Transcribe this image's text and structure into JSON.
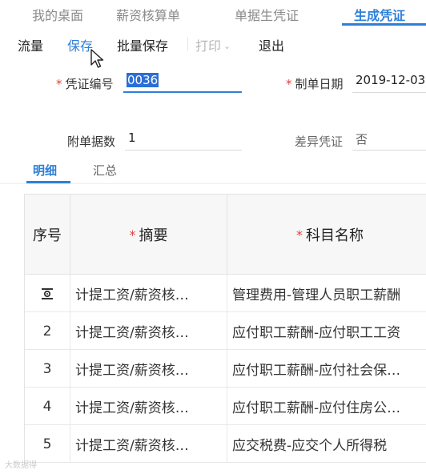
{
  "tabs": [
    {
      "label": "我的桌面"
    },
    {
      "label": "薪资核算单"
    },
    {
      "label": "单据生凭证"
    },
    {
      "label": "生成凭证"
    }
  ],
  "toolbar": {
    "flow": "流量",
    "save": "保存",
    "batch_save": "批量保存",
    "print": "打印",
    "exit": "退出"
  },
  "form": {
    "voucher_no_label": "凭证编号",
    "voucher_no_value": "0036",
    "date_label": "制单日期",
    "date_value": "2019-12-03",
    "attach_label": "附单据数",
    "attach_value": "1",
    "diff_label": "差异凭证",
    "diff_value": "否"
  },
  "subtabs": {
    "detail": "明细",
    "summary": "汇总"
  },
  "table": {
    "headers": {
      "seq": "序号",
      "summary": "摘要",
      "account": "科目名称"
    },
    "rows": [
      {
        "seq": "",
        "summary": "计提工资/薪资核…",
        "account": "管理费用-管理人员职工薪酬"
      },
      {
        "seq": "2",
        "summary": "计提工资/薪资核…",
        "account": "应付职工薪酬-应付职工工资"
      },
      {
        "seq": "3",
        "summary": "计提工资/薪资核…",
        "account": "应付职工薪酬-应付社会保…"
      },
      {
        "seq": "4",
        "summary": "计提工资/薪资核…",
        "account": "应付职工薪酬-应付住房公…"
      },
      {
        "seq": "5",
        "summary": "计提工资/薪资核…",
        "account": "应交税费-应交个人所得税"
      }
    ]
  },
  "watermark": "大数据得",
  "colors": {
    "accent": "#2f7fd8",
    "required": "#e0413d"
  }
}
